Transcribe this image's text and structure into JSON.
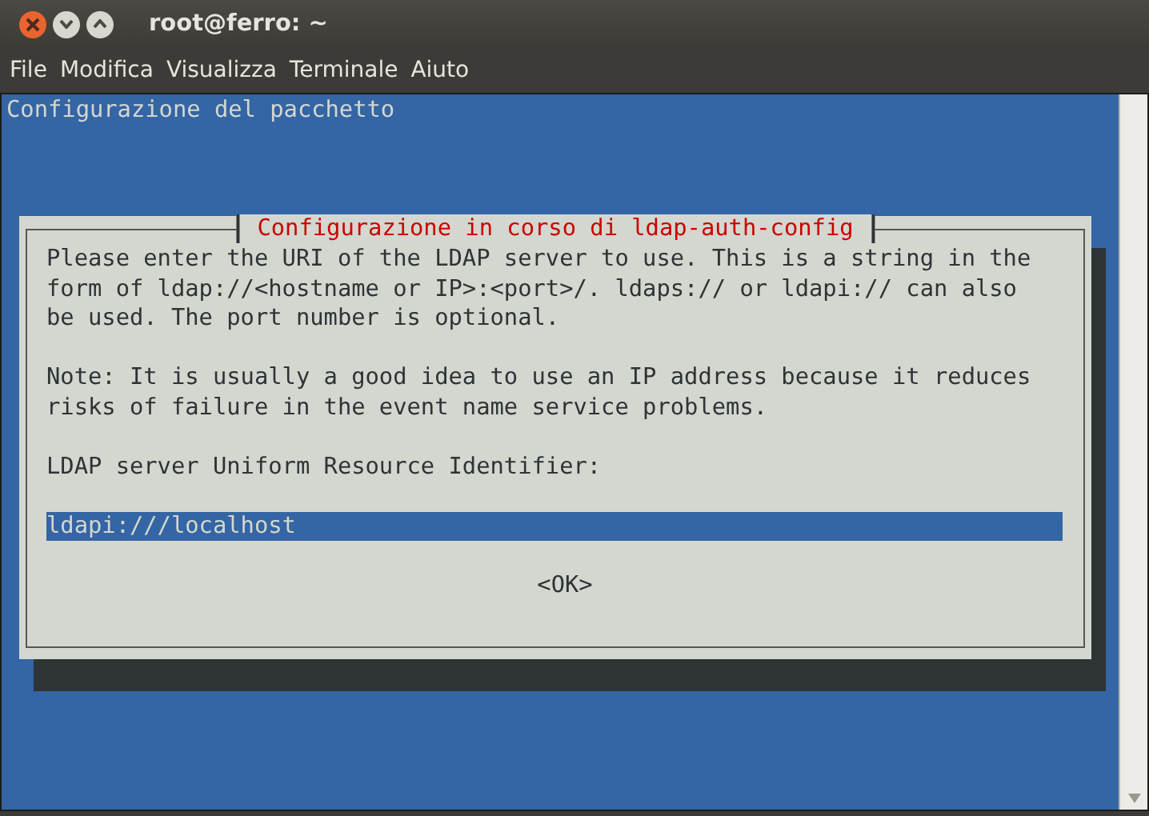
{
  "window": {
    "title": "root@ferro: ~"
  },
  "menu": [
    "File",
    "Modifica",
    "Visualizza",
    "Terminale",
    "Aiuto"
  ],
  "terminal": {
    "header": "Configurazione del pacchetto",
    "dialog": {
      "title": "Configurazione in corso di ldap-auth-config",
      "paragraphs": [
        "Please enter the URI of the LDAP server to use. This is a string in the\nform of ldap://<hostname or IP>:<port>/. ldaps:// or ldapi:// can also\nbe used. The port number is optional.",
        "Note: It is usually a good idea to use an IP address because it reduces\nrisks of failure in the event name service problems.",
        "LDAP server Uniform Resource Identifier:"
      ],
      "field": {
        "value": "ldapi:///localhost"
      },
      "button": "<OK>"
    }
  }
}
